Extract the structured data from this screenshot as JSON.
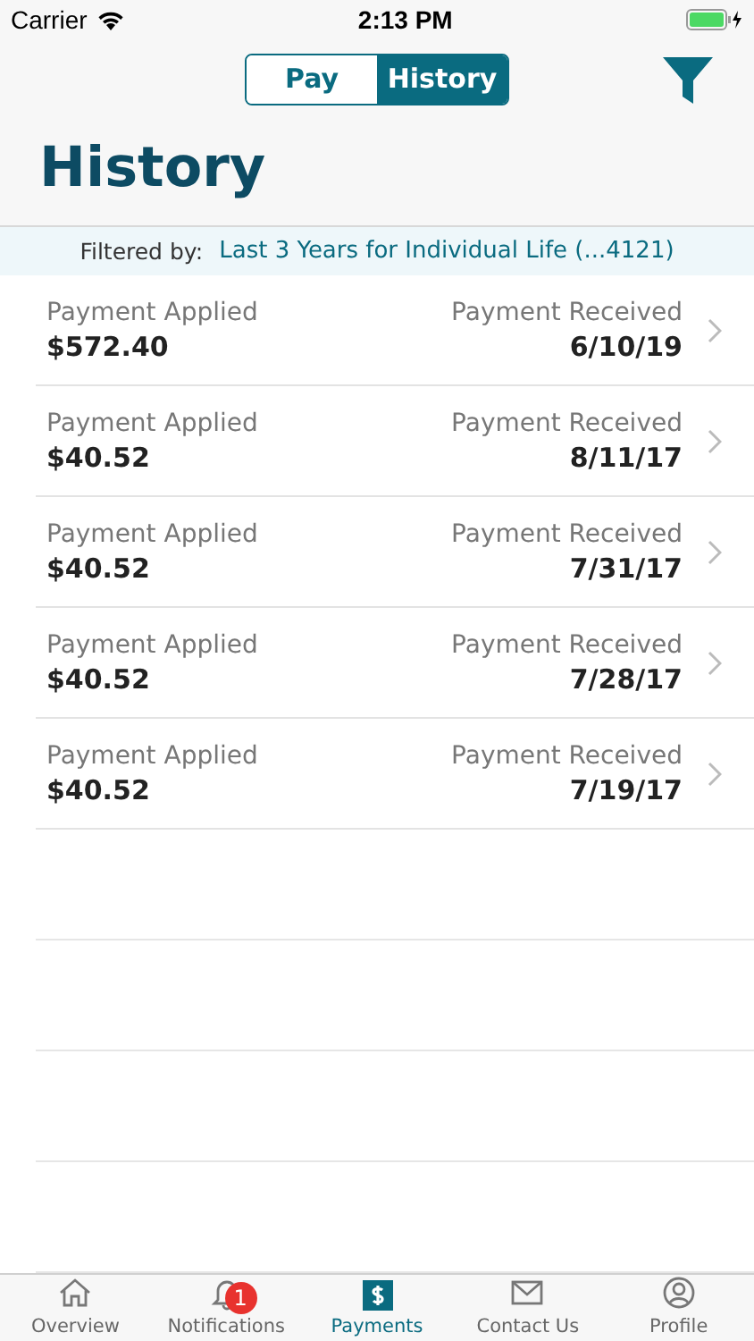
{
  "status_bar": {
    "carrier": "Carrier",
    "time": "2:13 PM"
  },
  "segments": [
    {
      "label": "Pay",
      "selected": false
    },
    {
      "label": "History",
      "selected": true
    }
  ],
  "title": "History",
  "filter": {
    "label": "Filtered by:",
    "value": "Last 3 Years for Individual Life (...4121)"
  },
  "payments": [
    {
      "type": "Payment Applied",
      "amount": "$572.40",
      "status": "Payment Received",
      "date": "6/10/19"
    },
    {
      "type": "Payment Applied",
      "amount": "$40.52",
      "status": "Payment Received",
      "date": "8/11/17"
    },
    {
      "type": "Payment Applied",
      "amount": "$40.52",
      "status": "Payment Received",
      "date": "7/31/17"
    },
    {
      "type": "Payment Applied",
      "amount": "$40.52",
      "status": "Payment Received",
      "date": "7/28/17"
    },
    {
      "type": "Payment Applied",
      "amount": "$40.52",
      "status": "Payment Received",
      "date": "7/19/17"
    }
  ],
  "tab_bar": [
    {
      "label": "Overview",
      "selected": false
    },
    {
      "label": "Notifications",
      "selected": false,
      "badge": "1"
    },
    {
      "label": "Payments",
      "selected": true
    },
    {
      "label": "Contact Us",
      "selected": false
    },
    {
      "label": "Profile",
      "selected": false
    }
  ]
}
